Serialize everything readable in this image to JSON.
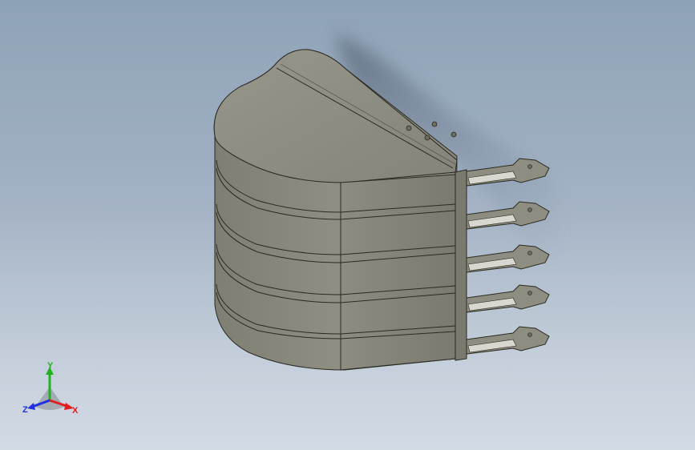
{
  "triad": {
    "x_label": "X",
    "y_label": "Y",
    "z_label": "Z"
  },
  "colors": {
    "background_top": "#8ea2b7",
    "background_bottom": "#d2dae4",
    "body": "#8f8f81",
    "body_light": "#a2a294",
    "body_dark": "#6e6e62",
    "edge": "#2a2a22",
    "axis_x": "#e02020",
    "axis_y": "#20b020",
    "axis_z": "#2030e0"
  },
  "icons": {
    "triad": "coordinate-triad-icon"
  }
}
